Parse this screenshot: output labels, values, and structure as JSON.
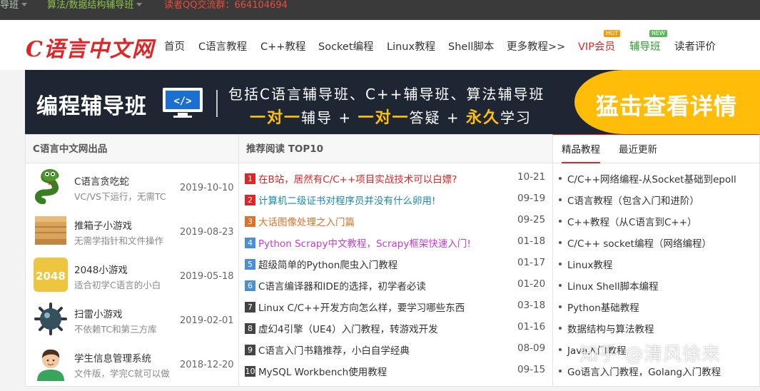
{
  "topbar": {
    "item1": "导班",
    "item2": "算法/数据结构辅导班",
    "item3": "读者QQ交流群：664104694"
  },
  "header": {
    "logo": "C语言中文网",
    "nav": [
      "首页",
      "C语言教程",
      "C++教程",
      "Socket编程",
      "Linux教程",
      "Shell脚本",
      "更多教程>>",
      "VIP会员",
      "辅导班",
      "读者评价"
    ],
    "badges": {
      "hot": "HOT",
      "new": "NEW"
    }
  },
  "banner": {
    "title": "编程辅导班",
    "line1": "包括C语言辅导班、C++辅导班、算法辅导班",
    "line2_parts": [
      "一对一",
      "辅导 + ",
      "一对一",
      "答疑 + ",
      "永久",
      "学习"
    ],
    "cta": "猛击查看详情"
  },
  "panel_products": {
    "header": "C语言中文网出品",
    "items": [
      {
        "icon": "snake-icon",
        "title": "C语言贪吃蛇",
        "desc": "VC/VS下运行，无需TC",
        "date": "2019-10-10"
      },
      {
        "icon": "box-icon",
        "title": "推箱子小游戏",
        "desc": "无需学指针和文件操作",
        "date": "2019-08-23"
      },
      {
        "icon": "2048-icon",
        "icon_text": "2048",
        "title": "2048小游戏",
        "desc": "适合初学C语言的小白",
        "date": "2019-05-18"
      },
      {
        "icon": "mine-icon",
        "title": "扫雷小游戏",
        "desc": "不依赖TC和第三方库",
        "date": "2019-02-01"
      },
      {
        "icon": "student-icon",
        "title": "学生信息管理系统",
        "desc": "文件版，学完C就可以做",
        "date": "2018-12-20"
      }
    ]
  },
  "panel_top10": {
    "header": "推荐阅读 TOP10",
    "items": [
      {
        "num": "1",
        "title": "在B站，居然有C/C++项目实战技术可以白嫖?",
        "date": "10-21",
        "color": "#e02525"
      },
      {
        "num": "2",
        "title": "计算机二级证书对程序员并没有什么卵用!",
        "date": "09-19",
        "color": "#1a8bb0"
      },
      {
        "num": "3",
        "title": "大话图像处理之入门篇",
        "date": "09-25",
        "color": "#e0702a"
      },
      {
        "num": "4",
        "title": "Python Scrapy中文教程，Scrapy框架快速入门!",
        "date": "01-18",
        "color": "#c53ccf"
      },
      {
        "num": "5",
        "title": "超级简单的Python爬虫入门教程",
        "date": "01-17",
        "color": "#333333"
      },
      {
        "num": "6",
        "title": "C语言编译器和IDE的选择，初学者必读",
        "date": "01-20",
        "color": "#333333"
      },
      {
        "num": "7",
        "title": "Linux C/C++开发方向怎么样，要学习哪些东西",
        "date": "03-18",
        "color": "#333333"
      },
      {
        "num": "8",
        "title": "虚幻4引擎（UE4）入门教程，转游戏开发",
        "date": "01-16",
        "color": "#333333"
      },
      {
        "num": "9",
        "title": "C语言入门书籍推荐，小白自学经典",
        "date": "08-09",
        "color": "#333333"
      },
      {
        "num": "10",
        "title": "MySQL Workbench使用教程",
        "date": "09-15",
        "color": "#333333"
      }
    ],
    "num_colors": [
      "#e02525",
      "#e02525",
      "#e0702a",
      "#4a90d9",
      "#4a90d9",
      "#4a90d9",
      "#444444",
      "#444444",
      "#444444",
      "#444444"
    ]
  },
  "panel_tutorials": {
    "tabs": [
      "精品教程",
      "最近更新"
    ],
    "items": [
      "C/C++网络编程-从Socket基础到epoll",
      "C语言教程（包含入门和进阶）",
      "C++教程（从C语言到C++）",
      "C/C++ socket编程（网络编程）",
      "Linux教程",
      "Linux Shell脚本编程",
      "Python基础教程",
      "数据结构与算法教程",
      "Java入门教程",
      "Go语言入门教程，Golang入门教程"
    ]
  },
  "watermark": "知乎 @清风徐来"
}
